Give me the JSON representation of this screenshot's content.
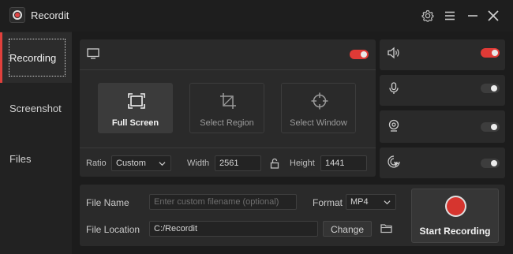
{
  "app": {
    "title": "Recordit"
  },
  "sidebar": {
    "items": [
      {
        "label": "Recording",
        "active": true
      },
      {
        "label": "Screenshot",
        "active": false
      },
      {
        "label": "Files",
        "active": false
      }
    ]
  },
  "display": {
    "icon": "monitor-icon",
    "toggle_on": true
  },
  "modes": [
    {
      "label": "Full Screen",
      "icon": "fullscreen-frame-icon",
      "active": true
    },
    {
      "label": "Select Region",
      "icon": "crop-icon",
      "active": false
    },
    {
      "label": "Select Window",
      "icon": "crosshair-icon",
      "active": false
    }
  ],
  "dimensions": {
    "ratio_label": "Ratio",
    "ratio_value": "Custom",
    "width_label": "Width",
    "width_value": "2561",
    "height_label": "Height",
    "height_value": "1441"
  },
  "sources": [
    {
      "icon": "speaker-icon",
      "toggle_on": true
    },
    {
      "icon": "microphone-icon",
      "toggle_on": false
    },
    {
      "icon": "webcam-icon",
      "toggle_on": false
    },
    {
      "icon": "cursor-click-icon",
      "toggle_on": false
    }
  ],
  "output": {
    "file_name_label": "File Name",
    "file_name_placeholder": "Enter custom filename (optional)",
    "format_label": "Format",
    "format_value": "MP4",
    "file_location_label": "File Location",
    "file_location_value": "C:/Recordit",
    "change_label": "Change"
  },
  "start": {
    "label": "Start Recording"
  },
  "colors": {
    "accent": "#e03a36",
    "background": "#1c1c1c",
    "panel": "#2a2a2a"
  }
}
